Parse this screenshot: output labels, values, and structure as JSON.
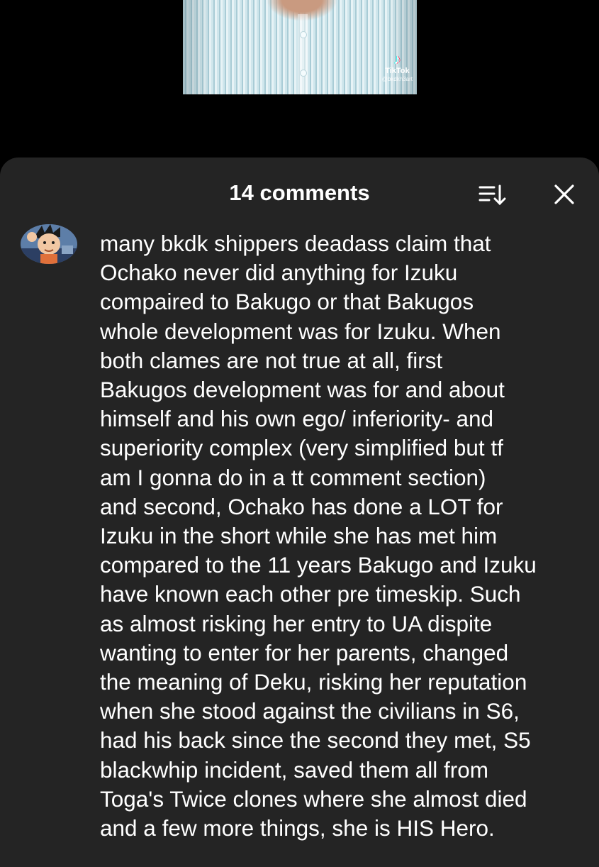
{
  "video": {
    "watermark_brand": "TikTok",
    "watermark_handle": "@bkdkh3art",
    "watermark_icon": "tiktok-note-icon"
  },
  "comments_sheet": {
    "title": "14 comments",
    "sort_icon": "sort-icon",
    "close_icon": "close-icon"
  },
  "comment": {
    "avatar_icon": "avatar-cartoon",
    "lines": [
      "many bkdk shippers deadass claim that",
      "Ochako never did anything for Izuku",
      "compaired to Bakugo or that Bakugos",
      "whole development was for Izuku. When",
      "both clames are not true at all, first",
      "Bakugos development was for and about",
      "himself and his own ego/ inferiority- and",
      "superiority complex (very simplified but tf",
      "am I gonna do in a tt comment section)",
      "and second, Ochako has done a LOT for",
      "Izuku in the short while she has met him",
      "compared to the 11 years Bakugo and Izuku",
      "have known each other pre timeskip. Such",
      "as almost risking her entry to UA dispite",
      "wanting to enter for her parents, changed",
      "the meaning of Deku, risking her reputation",
      "when she stood against the civilians in S6,",
      "had his back since the second they met, S5",
      "blackwhip incident, saved them all from",
      "Toga's Twice clones where she almost died",
      "and a few more things, she is HIS Hero."
    ]
  },
  "colors": {
    "page_background": "#000000",
    "sheet_background": "#242424",
    "text": "#ffffff"
  }
}
